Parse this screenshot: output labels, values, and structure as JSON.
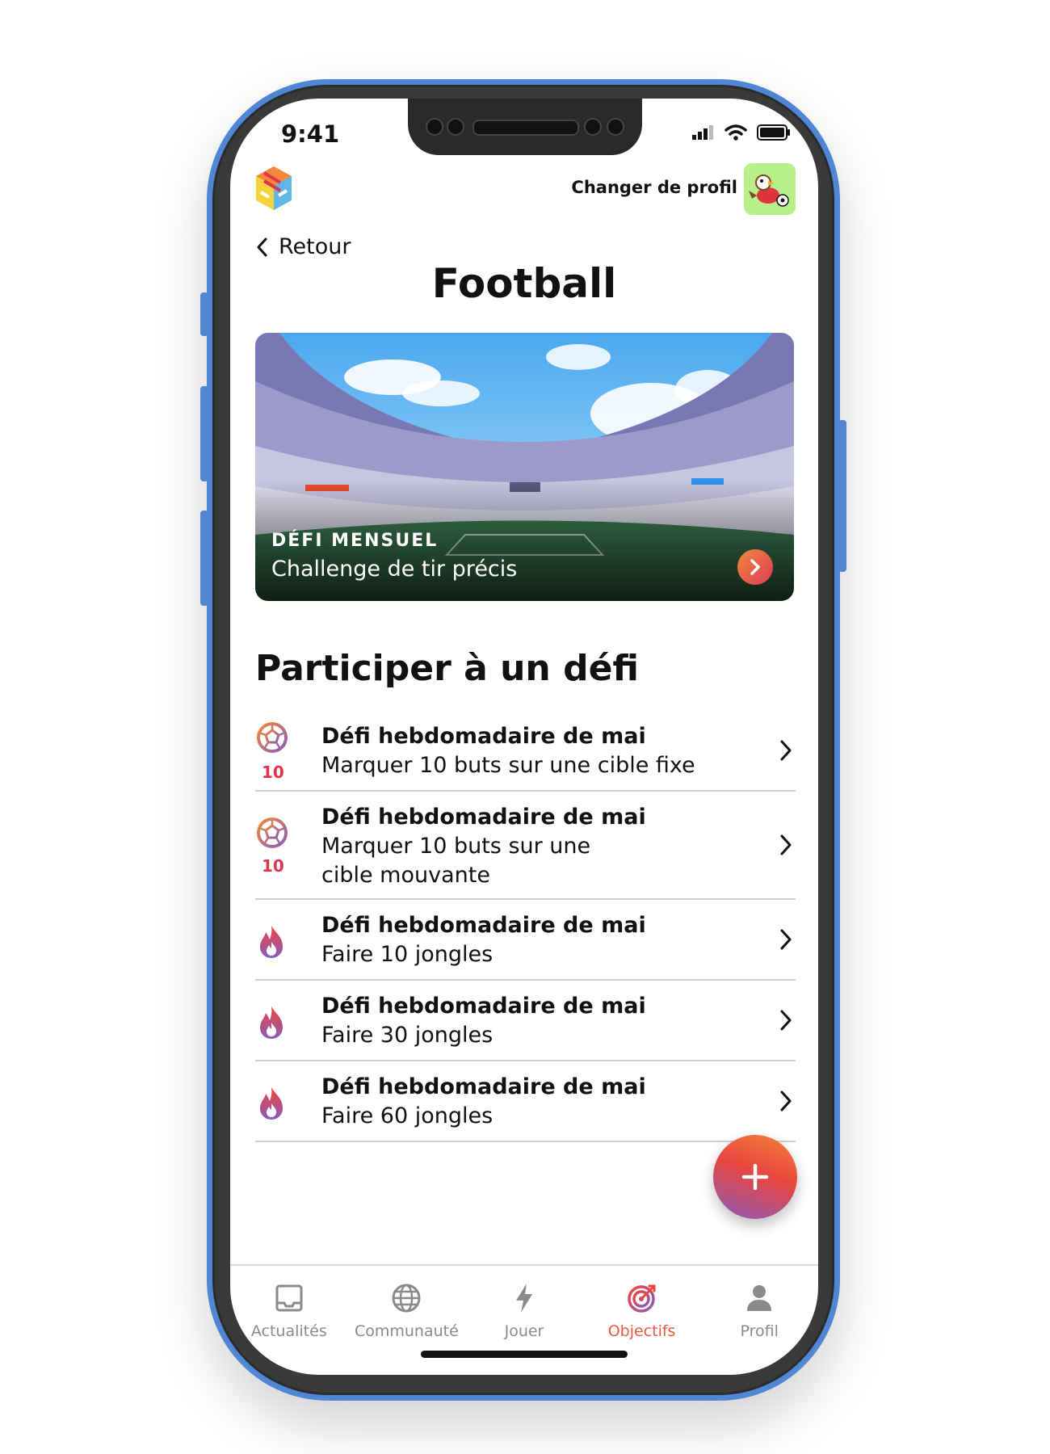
{
  "status_bar": {
    "time": "9:41"
  },
  "header": {
    "profile_switch_label": "Changer de profil",
    "back_label": "Retour",
    "page_title": "Football"
  },
  "banner": {
    "kicker": "DÉFI MENSUEL",
    "caption": "Challenge de tir précis"
  },
  "section_title": "Participer à un défi",
  "challenges": [
    {
      "icon": "soccer-ball-icon",
      "badge": "10",
      "title": "Défi hebdomadaire de mai",
      "subtitle": "Marquer 10 buts sur une cible fixe"
    },
    {
      "icon": "soccer-ball-icon",
      "badge": "10",
      "title": "Défi hebdomadaire de mai",
      "subtitle": "Marquer 10 buts sur une cible mouvante"
    },
    {
      "icon": "flame-icon",
      "badge": "",
      "title": "Défi hebdomadaire de mai",
      "subtitle": "Faire 10 jongles"
    },
    {
      "icon": "flame-icon",
      "badge": "",
      "title": "Défi hebdomadaire de mai",
      "subtitle": "Faire 30 jongles"
    },
    {
      "icon": "flame-icon",
      "badge": "",
      "title": "Défi hebdomadaire de mai",
      "subtitle": "Faire 60 jongles"
    }
  ],
  "tabbar": {
    "items": [
      {
        "label": "Actualités",
        "icon": "inbox-icon",
        "active": false
      },
      {
        "label": "Communauté",
        "icon": "globe-icon",
        "active": false
      },
      {
        "label": "Jouer",
        "icon": "lightning-icon",
        "active": false
      },
      {
        "label": "Objectifs",
        "icon": "target-icon",
        "active": true
      },
      {
        "label": "Profil",
        "icon": "person-icon",
        "active": false
      }
    ]
  },
  "colors": {
    "accent": "#ec5a3f",
    "phone_frame": "#4f86d6",
    "avatar_bg": "#b7ef8a",
    "badge_red": "#e2334a"
  }
}
